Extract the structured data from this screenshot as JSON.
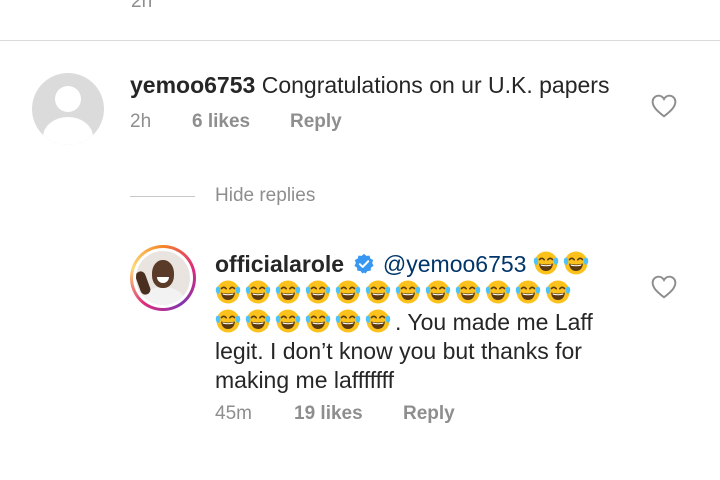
{
  "previous": {
    "time": "2h"
  },
  "comment1": {
    "username": "yemoo6753",
    "text": "Congratulations on ur U.K. papers",
    "time": "2h",
    "likes": "6 likes",
    "reply_label": "Reply"
  },
  "hide_replies_label": "Hide replies",
  "comment2": {
    "username": "officialarole",
    "mention": "@yemoo6753",
    "text_after_emojis": ". You made me Laff legit. I don’t know you but thanks for making me lafffffff",
    "emoji_icon": "face-with-tears-of-joy-icon",
    "emoji_rows": [
      2,
      12,
      6
    ],
    "time": "45m",
    "likes": "19 likes",
    "reply_label": "Reply"
  },
  "colors": {
    "text": "#262626",
    "meta": "#8e8e8e",
    "mention": "#003569",
    "verified": "#3897f0",
    "divider": "#dbdbdb"
  }
}
